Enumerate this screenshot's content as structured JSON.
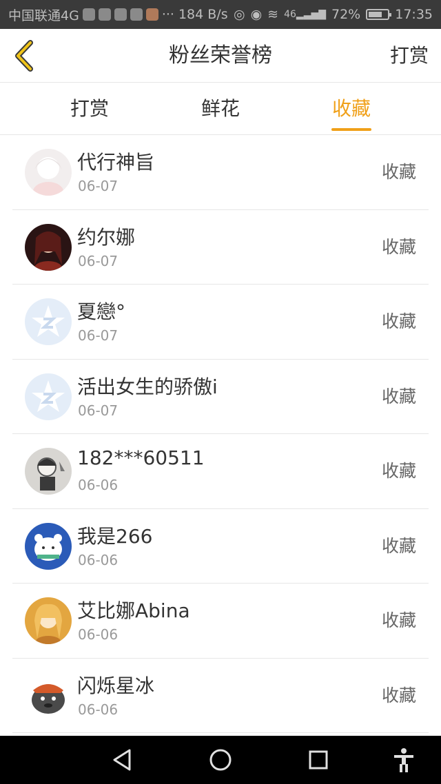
{
  "status_bar": {
    "carrier": "中国联通4G",
    "speed": "··· 184 B/s",
    "signal_label": "46",
    "battery": "72%",
    "time": "17:35",
    "battery_level": 0.72
  },
  "header": {
    "title": "粉丝荣誉榜",
    "right_link": "打赏",
    "back_icon": "chevron-left-icon"
  },
  "tabs": [
    {
      "label": "打赏",
      "active": false
    },
    {
      "label": "鲜花",
      "active": false
    },
    {
      "label": "收藏",
      "active": true
    }
  ],
  "colors": {
    "accent": "#f0a019",
    "text": "#333333",
    "secondary": "#999999",
    "divider": "#e6e6e6"
  },
  "fans": [
    {
      "name": "代行神旨",
      "date": "06-07",
      "action": "收藏",
      "avatar": "anime-girl-white"
    },
    {
      "name": "约尔娜",
      "date": "06-07",
      "action": "收藏",
      "avatar": "dark-portrait"
    },
    {
      "name": "夏戀°",
      "date": "06-07",
      "action": "收藏",
      "avatar": "qq-default-star"
    },
    {
      "name": "活出女生的骄傲i",
      "date": "06-07",
      "action": "收藏",
      "avatar": "qq-default-star"
    },
    {
      "name": "182***60511",
      "date": "06-06",
      "action": "收藏",
      "avatar": "sketch-portrait"
    },
    {
      "name": "我是266",
      "date": "06-06",
      "action": "收藏",
      "avatar": "white-bear-blue"
    },
    {
      "name": "艾比娜Abina",
      "date": "06-06",
      "action": "收藏",
      "avatar": "golden-anime-girl"
    },
    {
      "name": "闪烁星冰",
      "date": "06-06",
      "action": "收藏",
      "avatar": "cartoon-bear-hat"
    }
  ],
  "nav_bar": [
    "back-triangle-icon",
    "home-circle-icon",
    "recents-square-icon",
    "accessibility-icon"
  ]
}
